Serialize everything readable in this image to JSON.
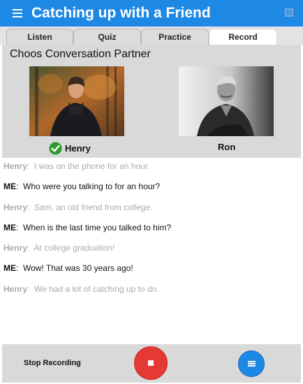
{
  "header": {
    "title": "Catching up with a Friend",
    "menu_icon": "hamburger-menu-icon",
    "right_icon": "book-icon",
    "bar_color": "#1e88e5"
  },
  "tabs": [
    {
      "label": "Listen",
      "active": false
    },
    {
      "label": "Quiz",
      "active": false
    },
    {
      "label": "Practice",
      "active": false
    },
    {
      "label": "Record",
      "active": true
    }
  ],
  "partner_panel": {
    "title": "Choos Conversation Partner",
    "partners": [
      {
        "name": "Henry",
        "selected": true
      },
      {
        "name": "Ron",
        "selected": false
      }
    ],
    "selected_icon": "green-check-icon"
  },
  "conversation": [
    {
      "speaker": "Henry",
      "text": "I was on the phone for an hour."
    },
    {
      "speaker": "ME",
      "text": "Who were you talking to for an hour?"
    },
    {
      "speaker": "Henry",
      "text": "Sam, an old friend from college."
    },
    {
      "speaker": "ME",
      "text": "When is the last time you talked to him?"
    },
    {
      "speaker": "Henry",
      "text": "At college graduation!"
    },
    {
      "speaker": "ME",
      "text": "Wow!  That was 30 years ago!"
    },
    {
      "speaker": "Henry",
      "text": "We had a lot of catching up to do."
    }
  ],
  "bottom_bar": {
    "stop_label": "Stop Recording",
    "record_button_icon": "stop-square-icon",
    "record_button_color": "#e53935",
    "list_button_icon": "list-icon",
    "list_button_color": "#1e88e5"
  }
}
